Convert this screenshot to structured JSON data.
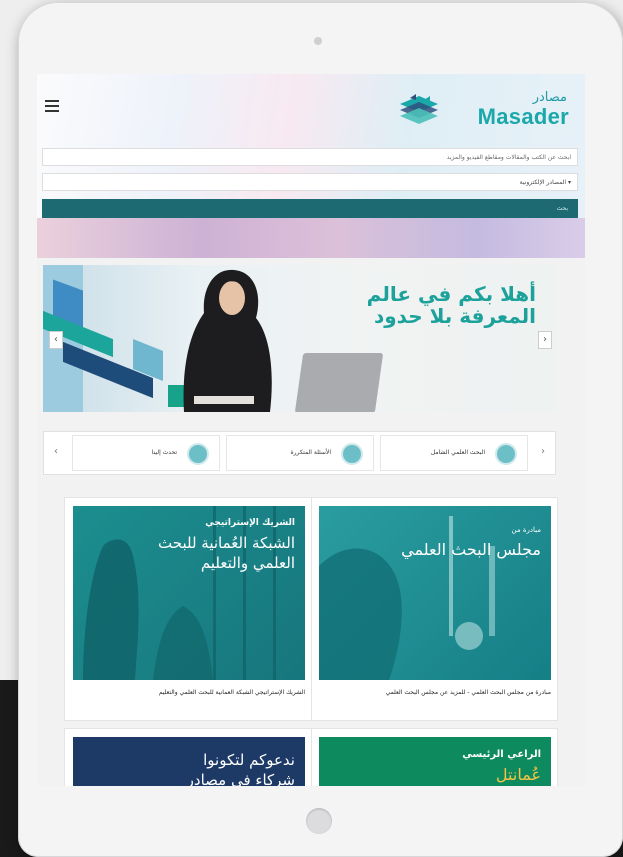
{
  "header": {
    "logo_ar": "مصادر",
    "logo_en": "Masader",
    "search_placeholder": "ابحث عن الكتب والمقالات ومقاطع الفيديو والمزيد",
    "source_select": "▾ المصادر الإلكترونية",
    "search_button": "بحث"
  },
  "hero": {
    "title_line1": "أهلا بكم في عالم",
    "title_line2": "المعرفة بلا حدود",
    "prev": "‹",
    "next": "›"
  },
  "quick_links": {
    "items": [
      "البحث العلمي الشامل",
      "الأسئلة المتكررة",
      "تحدث إلينا"
    ],
    "prev": "‹",
    "next": "›"
  },
  "cards": [
    {
      "overlay_small": "مبادرة من",
      "overlay_big": "مجلس البحث العلمي",
      "caption": "مبادرة من مجلس البحث العلمي - للمزيد عن مجلس البحث العلمي"
    },
    {
      "overlay_small": "الشريك الإستراتيجي",
      "overlay_big_1": "الشبكة العُمانية للبحث",
      "overlay_big_2": "العلمي والتعليم",
      "caption": "الشريك الإستراتيجي الشبكة العمانية للبحث العلمي والتعليم"
    },
    {
      "overlay_1": "الراعي الرئيسي",
      "overlay_2": "عُمانتل"
    },
    {
      "overlay_1": "ندعوكم لتكونوا",
      "overlay_2": "شركاء في مصادر"
    }
  ],
  "colors": {
    "teal": "#1ca19b",
    "dark_teal": "#1e6a73",
    "card_teal": "#1a8f93",
    "navy": "#1d3a66"
  },
  "icons": [
    "menu-icon",
    "masader-logo-mark",
    "chevron-left-icon",
    "chevron-right-icon",
    "research-icon",
    "faq-icon",
    "chat-icon"
  ]
}
